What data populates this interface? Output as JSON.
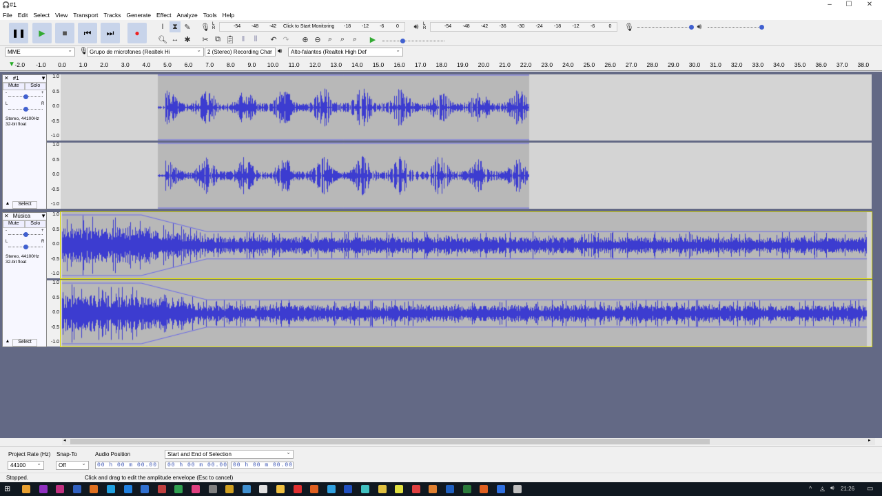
{
  "window": {
    "title": "#1"
  },
  "menu": [
    "File",
    "Edit",
    "Select",
    "View",
    "Transport",
    "Tracks",
    "Generate",
    "Effect",
    "Analyze",
    "Tools",
    "Help"
  ],
  "meters": {
    "record_ticks": [
      "-54",
      "-48",
      "-42",
      "-18",
      "-12",
      "-6",
      "0"
    ],
    "record_prompt": "Click to Start Monitoring",
    "play_ticks": [
      "-54",
      "-48",
      "-42",
      "-36",
      "-30",
      "-24",
      "-18",
      "-12",
      "-6",
      "0"
    ],
    "L": "L",
    "R": "R"
  },
  "devices": {
    "host": "MME",
    "input": "Grupo de microfones (Realtek Hi",
    "channels": "2 (Stereo) Recording Char",
    "output": "Alto-falantes (Realtek High Def"
  },
  "ruler": {
    "ticks": [
      "-2.0",
      "-1.0",
      "0.0",
      "1.0",
      "2.0",
      "3.0",
      "4.0",
      "5.0",
      "6.0",
      "7.0",
      "8.0",
      "9.0",
      "10.0",
      "11.0",
      "12.0",
      "13.0",
      "14.0",
      "15.0",
      "16.0",
      "17.0",
      "18.0",
      "19.0",
      "20.0",
      "21.0",
      "22.0",
      "23.0",
      "24.0",
      "25.0",
      "26.0",
      "27.0",
      "28.0",
      "29.0",
      "30.0",
      "31.0",
      "32.0",
      "33.0",
      "34.0",
      "35.0",
      "36.0",
      "37.0",
      "38.0"
    ]
  },
  "tracks": [
    {
      "name": "#1",
      "mute": "Mute",
      "solo": "Solo",
      "info1": "Stereo, 44100Hz",
      "info2": "32-bit float",
      "select": "Select",
      "gain_minus": "-",
      "gain_plus": "+",
      "pan_l": "L",
      "pan_r": "R",
      "scale": [
        "1.0",
        "0.5",
        "0.0",
        "-0.5",
        "-1.0"
      ]
    },
    {
      "name": "Música",
      "mute": "Mute",
      "solo": "Solo",
      "info1": "Stereo, 44100Hz",
      "info2": "32-bit float",
      "select": "Select",
      "gain_minus": "-",
      "gain_plus": "+",
      "pan_l": "L",
      "pan_r": "R",
      "scale": [
        "1.0",
        "0.5",
        "0.0",
        "-0.5",
        "-1.0"
      ]
    }
  ],
  "colors": {
    "wave": "#3c3cd0",
    "background": "#636985",
    "clip": "#b8b8b8",
    "track_bg": "#d4d4d4"
  },
  "selection_bar": {
    "project_rate_label": "Project Rate (Hz)",
    "project_rate": "44100",
    "snap_label": "Snap-To",
    "snap": "Off",
    "audio_pos_label": "Audio Position",
    "audio_pos": "00 h 00 m 00.00 s",
    "selection_mode": "Start and End of Selection",
    "sel_start": "00 h 00 m 00.00 s",
    "sel_end": "00 h 00 m 00.00 s"
  },
  "status": {
    "state": "Stopped.",
    "hint": "Click and drag to edit the amplitude envelope (Esc to cancel)"
  },
  "taskbar": {
    "time": "21:26"
  }
}
